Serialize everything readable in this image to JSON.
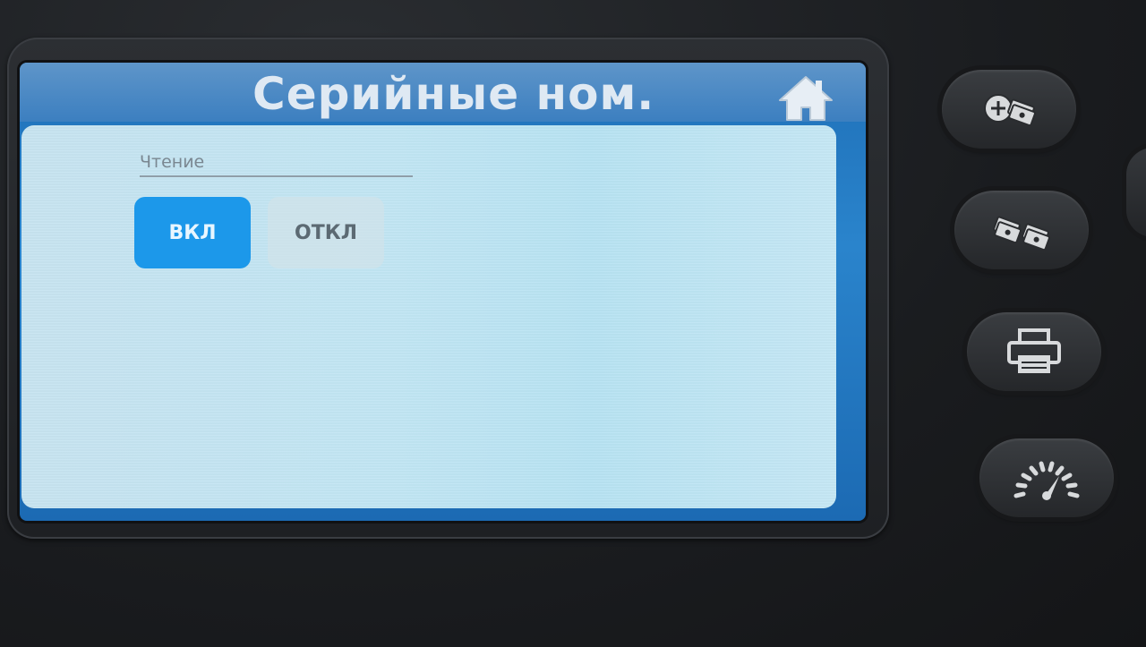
{
  "screen": {
    "title": "Серийные ном.",
    "home_icon": "home-icon"
  },
  "reading": {
    "label": "Чтение",
    "on_label": "ВКЛ",
    "off_label": "ОТКЛ",
    "selected": "ВКЛ"
  },
  "hardware_buttons": [
    {
      "name": "add-currency-button",
      "icon": "add-money-icon"
    },
    {
      "name": "mixed-currency-button",
      "icon": "two-money-stacks-icon"
    },
    {
      "name": "print-button",
      "icon": "printer-icon"
    },
    {
      "name": "speed-button",
      "icon": "speedometer-icon"
    }
  ],
  "colors": {
    "selected": "#1c98ea",
    "header": "#3c7fc0",
    "panel": "#c2e6f4"
  }
}
